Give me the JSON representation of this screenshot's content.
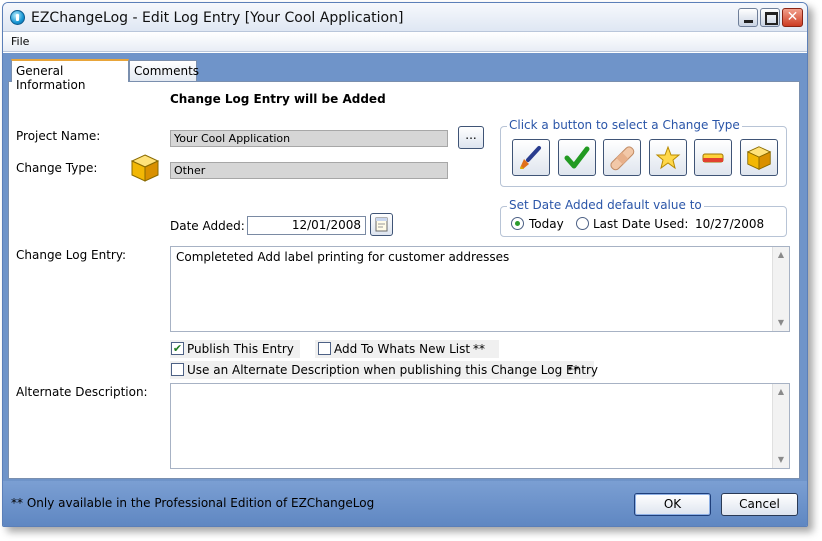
{
  "window": {
    "title": "EZChangeLog - Edit Log Entry [Your Cool Application]",
    "close_glyph": "✕"
  },
  "menu": {
    "file": "File"
  },
  "tabs": [
    {
      "label": "General Information",
      "active": true
    },
    {
      "label": "Comments",
      "active": false
    }
  ],
  "form": {
    "heading": "Change Log Entry will be Added",
    "project_name_label": "Project Name:",
    "project_name_value": "Your Cool Application",
    "browse_label": "...",
    "change_type_label": "Change Type:",
    "change_type_value": "Other",
    "change_type_icon": "cube-icon",
    "date_added_label": "Date Added:",
    "date_added_value": "12/01/2008",
    "change_log_entry_label": "Change Log Entry:",
    "change_log_entry_value": "Completeted Add label printing for customer addresses",
    "publish_label": "Publish This Entry",
    "publish_checked": true,
    "whats_new_label": "Add To Whats New List",
    "whats_new_note": "**",
    "whats_new_checked": false,
    "alternate_use_label": "Use an Alternate Description when publishing this Change Log Entry",
    "alternate_use_note": "**",
    "alternate_use_checked": false,
    "alternate_description_label": "Alternate Description:",
    "alternate_description_value": ""
  },
  "change_type_group": {
    "legend": "Click a button to select a Change Type",
    "buttons": [
      {
        "icon": "paintbrush-icon"
      },
      {
        "icon": "checkmark-icon"
      },
      {
        "icon": "bandage-icon"
      },
      {
        "icon": "star-icon"
      },
      {
        "icon": "eraser-icon"
      },
      {
        "icon": "cube-icon"
      }
    ]
  },
  "date_default_group": {
    "legend": "Set Date Added default value to",
    "today_label": "Today",
    "today_selected": true,
    "last_date_label": "Last Date Used:",
    "last_date_value": "10/27/2008"
  },
  "footer": {
    "note": "** Only available in the Professional Edition of EZChangeLog",
    "ok_label": "OK",
    "cancel_label": "Cancel"
  },
  "colors": {
    "footer_blue": "#6f94c9",
    "legend_blue": "#2a55a8",
    "check_green": "#1f7a1f",
    "tab_accent": "#e8a53a"
  }
}
